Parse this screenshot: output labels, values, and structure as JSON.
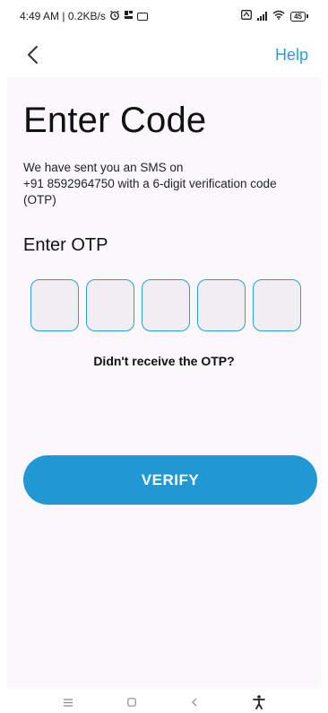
{
  "status_bar": {
    "time_speed": "4:49 AM | 0.2KB/s",
    "battery": "45"
  },
  "header": {
    "back_icon": "chevron-left-icon",
    "help_label": "Help"
  },
  "main": {
    "title": "Enter Code",
    "description_line1": "We have sent you an SMS on",
    "description_line2": "+91 8592964750 with a 6-digit verification code",
    "description_line3": "(OTP)",
    "otp_label": "Enter OTP",
    "otp_boxes": [
      "",
      "",
      "",
      "",
      ""
    ],
    "resend_label": "Didn't receive the OTP?",
    "verify_label": "VERIFY"
  },
  "nav": {
    "menu_icon": "menu-icon",
    "home_icon": "home-icon",
    "back_icon": "back-icon",
    "accessibility_icon": "accessibility-icon"
  },
  "colors": {
    "accent": "#1f98d3",
    "panel_bg": "#fbf8fc",
    "otp_box_bg": "#f0eef2"
  }
}
